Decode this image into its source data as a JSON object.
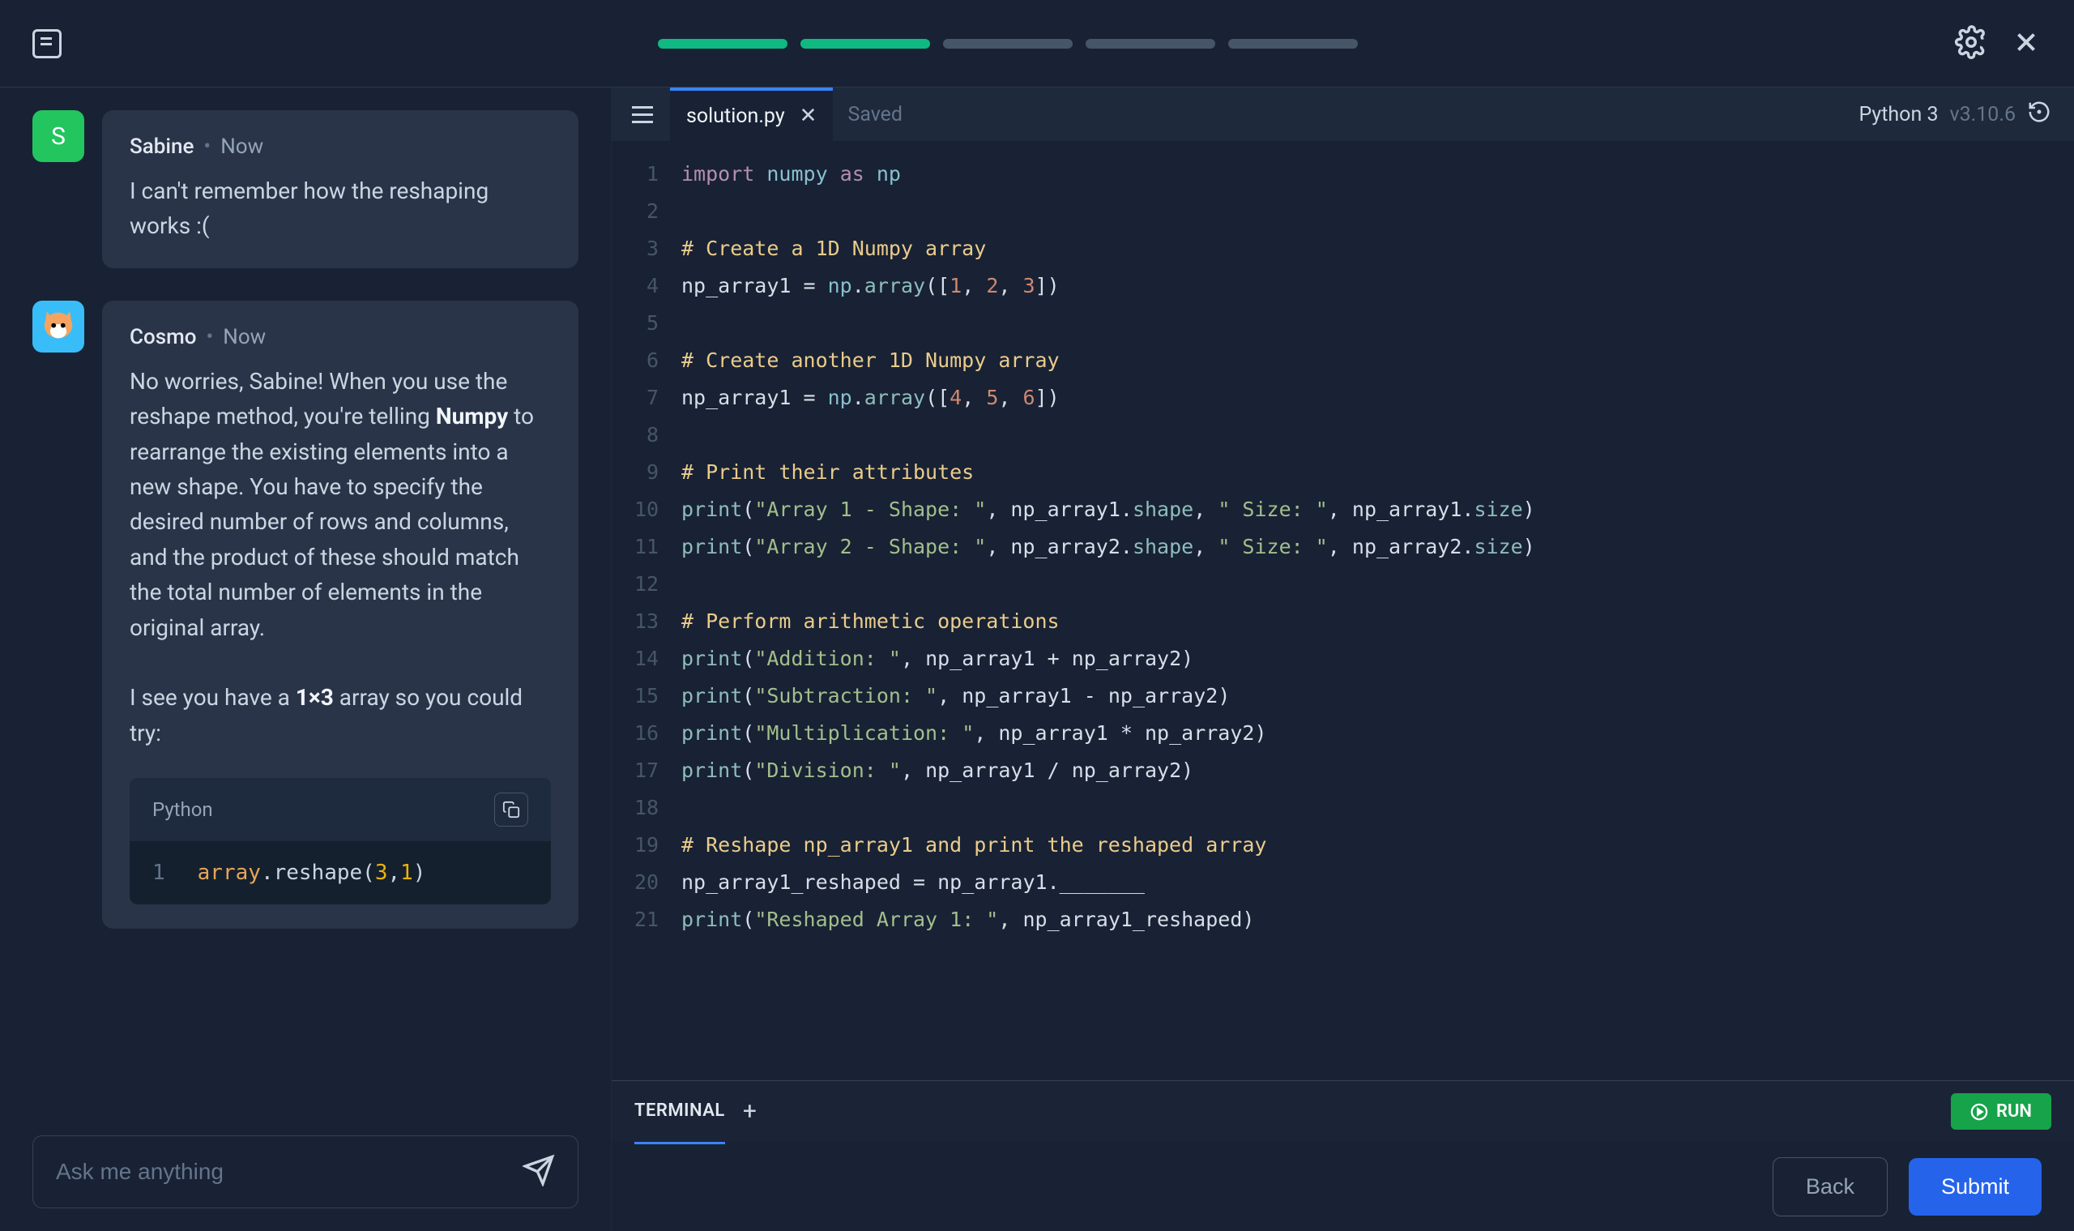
{
  "progress": {
    "completed": 2,
    "total": 5
  },
  "chat": {
    "user": {
      "avatar_letter": "S",
      "name": "Sabine",
      "time": "Now",
      "text": "I can't remember how the reshaping works :("
    },
    "bot": {
      "name": "Cosmo",
      "time": "Now",
      "body_part1": "No worries, Sabine! When you use the reshape method, you're telling ",
      "bold_word": "Numpy",
      "body_part2": " to rearrange the existing elements into a new shape. You have to specify the desired number of rows and columns, and the product of these should match the total number of elements in the original array.",
      "body_part3a": "I see you have a ",
      "body_part3b": "1×3",
      "body_part3c": " array so you could try:",
      "code_lang": "Python",
      "code_line_num": "1",
      "code_ident": "array",
      "code_method": ".reshape(",
      "code_arg1": "3",
      "code_comma": ",",
      "code_arg2": "1",
      "code_end": ")"
    },
    "input_placeholder": "Ask me anything"
  },
  "editor": {
    "filename": "solution.py",
    "saved_label": "Saved",
    "python_label": "Python 3",
    "python_version": "v3.10.6",
    "lines": [
      [
        [
          "kw",
          "import"
        ],
        [
          "sp",
          " "
        ],
        [
          "mod",
          "numpy"
        ],
        [
          "sp",
          " "
        ],
        [
          "kw",
          "as"
        ],
        [
          "sp",
          " "
        ],
        [
          "mod",
          "np"
        ]
      ],
      [],
      [
        [
          "com",
          "# Create a 1D Numpy array"
        ]
      ],
      [
        [
          "ident",
          "np_array1 "
        ],
        [
          "punct",
          "= "
        ],
        [
          "mod",
          "np"
        ],
        [
          "punct",
          "."
        ],
        [
          "fn",
          "array"
        ],
        [
          "punct",
          "(["
        ],
        [
          "numlit",
          "1"
        ],
        [
          "punct",
          ", "
        ],
        [
          "numlit",
          "2"
        ],
        [
          "punct",
          ", "
        ],
        [
          "numlit",
          "3"
        ],
        [
          "punct",
          "])"
        ]
      ],
      [],
      [
        [
          "com",
          "# Create another 1D Numpy array"
        ]
      ],
      [
        [
          "ident",
          "np_array1 "
        ],
        [
          "punct",
          "= "
        ],
        [
          "mod",
          "np"
        ],
        [
          "punct",
          "."
        ],
        [
          "fn",
          "array"
        ],
        [
          "punct",
          "(["
        ],
        [
          "numlit",
          "4"
        ],
        [
          "punct",
          ", "
        ],
        [
          "numlit",
          "5"
        ],
        [
          "punct",
          ", "
        ],
        [
          "numlit",
          "6"
        ],
        [
          "punct",
          "])"
        ]
      ],
      [],
      [
        [
          "com",
          "# Print their attributes"
        ]
      ],
      [
        [
          "fn",
          "print"
        ],
        [
          "punct",
          "("
        ],
        [
          "str",
          "\"Array 1 - Shape: \""
        ],
        [
          "punct",
          ", "
        ],
        [
          "ident",
          "np_array1"
        ],
        [
          "punct",
          "."
        ],
        [
          "fn",
          "shape"
        ],
        [
          "punct",
          ", "
        ],
        [
          "str",
          "\" Size: \""
        ],
        [
          "punct",
          ", "
        ],
        [
          "ident",
          "np_array1"
        ],
        [
          "punct",
          "."
        ],
        [
          "fn",
          "size"
        ],
        [
          "punct",
          ")"
        ]
      ],
      [
        [
          "fn",
          "print"
        ],
        [
          "punct",
          "("
        ],
        [
          "str",
          "\"Array 2 - Shape: \""
        ],
        [
          "punct",
          ", "
        ],
        [
          "ident",
          "np_array2"
        ],
        [
          "punct",
          "."
        ],
        [
          "fn",
          "shape"
        ],
        [
          "punct",
          ", "
        ],
        [
          "str",
          "\" Size: \""
        ],
        [
          "punct",
          ", "
        ],
        [
          "ident",
          "np_array2"
        ],
        [
          "punct",
          "."
        ],
        [
          "fn",
          "size"
        ],
        [
          "punct",
          ")"
        ]
      ],
      [],
      [
        [
          "com",
          "# Perform arithmetic operations"
        ]
      ],
      [
        [
          "fn",
          "print"
        ],
        [
          "punct",
          "("
        ],
        [
          "str",
          "\"Addition: \""
        ],
        [
          "punct",
          ", "
        ],
        [
          "ident",
          "np_array1 "
        ],
        [
          "punct",
          "+ "
        ],
        [
          "ident",
          "np_array2"
        ],
        [
          "punct",
          ")"
        ]
      ],
      [
        [
          "fn",
          "print"
        ],
        [
          "punct",
          "("
        ],
        [
          "str",
          "\"Subtraction: \""
        ],
        [
          "punct",
          ", "
        ],
        [
          "ident",
          "np_array1 "
        ],
        [
          "punct",
          "- "
        ],
        [
          "ident",
          "np_array2"
        ],
        [
          "punct",
          ")"
        ]
      ],
      [
        [
          "fn",
          "print"
        ],
        [
          "punct",
          "("
        ],
        [
          "str",
          "\"Multiplication: \""
        ],
        [
          "punct",
          ", "
        ],
        [
          "ident",
          "np_array1 "
        ],
        [
          "punct",
          "* "
        ],
        [
          "ident",
          "np_array2"
        ],
        [
          "punct",
          ")"
        ]
      ],
      [
        [
          "fn",
          "print"
        ],
        [
          "punct",
          "("
        ],
        [
          "str",
          "\"Division: \""
        ],
        [
          "punct",
          ", "
        ],
        [
          "ident",
          "np_array1 "
        ],
        [
          "punct",
          "/ "
        ],
        [
          "ident",
          "np_array2"
        ],
        [
          "punct",
          ")"
        ]
      ],
      [],
      [
        [
          "com",
          "# Reshape np_array1 and print the reshaped array"
        ]
      ],
      [
        [
          "ident",
          "np_array1_reshaped "
        ],
        [
          "punct",
          "= "
        ],
        [
          "ident",
          "np_array1"
        ],
        [
          "punct",
          "."
        ],
        [
          "ident",
          "_______"
        ]
      ],
      [
        [
          "fn",
          "print"
        ],
        [
          "punct",
          "("
        ],
        [
          "str",
          "\"Reshaped Array 1: \""
        ],
        [
          "punct",
          ", "
        ],
        [
          "ident",
          "np_array1_reshaped"
        ],
        [
          "punct",
          ")"
        ]
      ]
    ]
  },
  "terminal": {
    "label": "TERMINAL",
    "run_label": "RUN"
  },
  "footer": {
    "back": "Back",
    "submit": "Submit"
  }
}
